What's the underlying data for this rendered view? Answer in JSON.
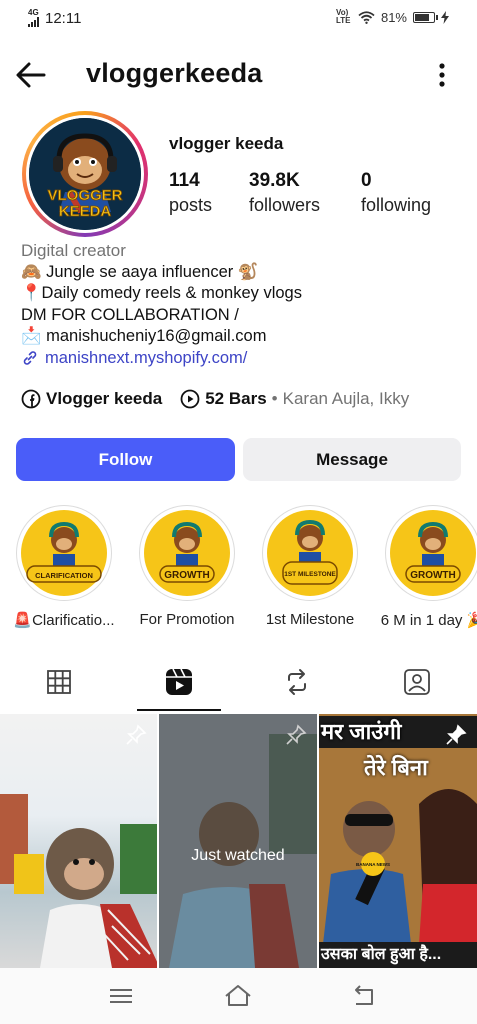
{
  "status_bar": {
    "network": "4G",
    "time": "12:11",
    "volte": "Vo) LTE",
    "battery_percent": "81%"
  },
  "header": {
    "username": "vloggerkeeda"
  },
  "profile": {
    "display_name": "vlogger keeda",
    "avatar_text": [
      "VLOGGER",
      "KEEDA"
    ],
    "stats": [
      {
        "value": "114",
        "label": "posts"
      },
      {
        "value": "39.8K",
        "label": "followers"
      },
      {
        "value": "0",
        "label": "following"
      }
    ]
  },
  "bio": {
    "category": "Digital creator",
    "line1": "🙈 Jungle se aaya influencer 🐒",
    "line2": "📍Daily comedy reels & monkey vlogs",
    "line3": "DM FOR COLLABORATION /",
    "line4": "📩 manishucheniy16@gmail.com",
    "link": "manishnext.myshopify.com/"
  },
  "meta": {
    "facebook_name": "Vlogger keeda",
    "music_count": "52 Bars",
    "separator": "•",
    "music_artist": "Karan Aujla, Ikky"
  },
  "buttons": {
    "follow": "Follow",
    "message": "Message"
  },
  "highlights": [
    {
      "badge": "CLARIFICATION",
      "caption": "🚨Clarificatio..."
    },
    {
      "badge": "GROWTH",
      "caption": "For Promotion"
    },
    {
      "badge": "1ST MILESTONE",
      "caption": "1st Milestone"
    },
    {
      "badge": "GROWTH",
      "caption": "6 M in 1 day 🎉"
    }
  ],
  "tabs": [
    "grid-icon",
    "reels-icon",
    "reposts-icon",
    "tagged-icon"
  ],
  "grid": {
    "just_watched": "Just watched",
    "hindi_top": "मर जाउंगी",
    "hindi_mid": "तेरे बिना",
    "hindi_bottom": "उसका बोल हुआ है...",
    "mic_label": "BANANA NEWS"
  },
  "colors": {
    "follow_bg": "#4a5df9",
    "message_bg": "#efeff1",
    "link": "#3d44c6",
    "highlight_yellow": "#f6c518"
  }
}
